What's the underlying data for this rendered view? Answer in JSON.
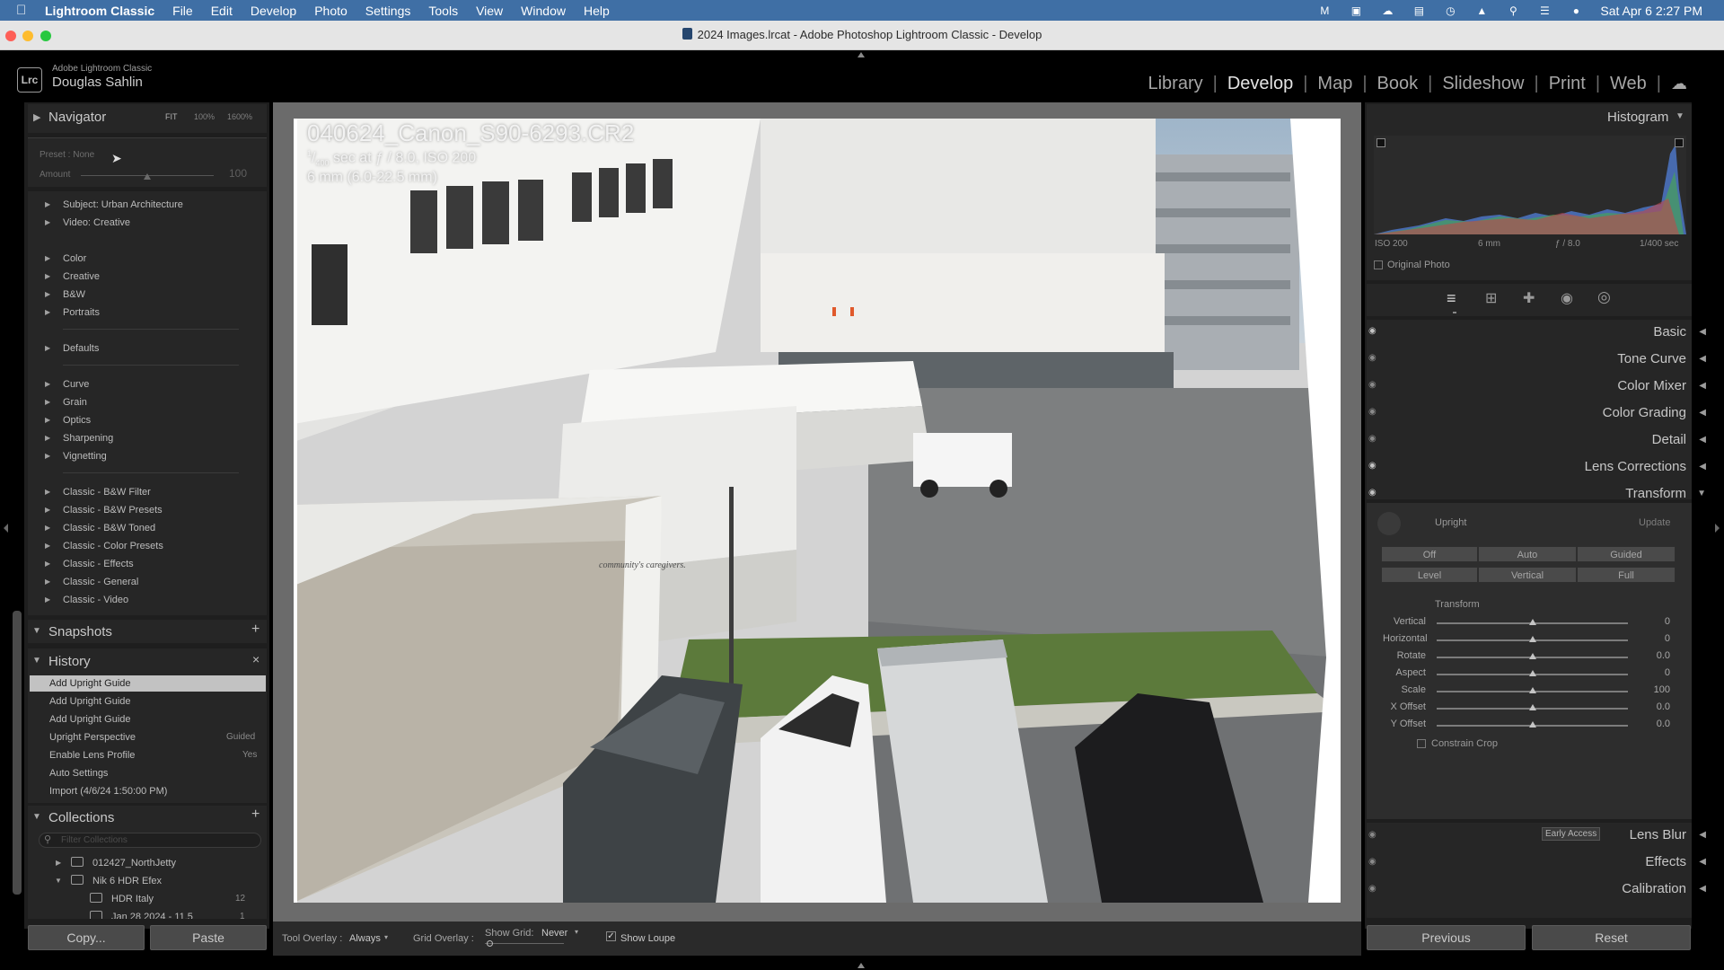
{
  "menubar": {
    "app": "Lightroom Classic",
    "items": [
      "File",
      "Edit",
      "Develop",
      "Photo",
      "Settings",
      "Tools",
      "View",
      "Window",
      "Help"
    ],
    "clock": "Sat Apr 6  2:27 PM"
  },
  "window": {
    "title": "2024 Images.lrcat - Adobe Photoshop Lightroom Classic - Develop"
  },
  "identity": {
    "logo": "Lrc",
    "brand": "Adobe Lightroom Classic",
    "user": "Douglas Sahlin"
  },
  "modules": [
    "Library",
    "Develop",
    "Map",
    "Book",
    "Slideshow",
    "Print",
    "Web"
  ],
  "navigator": {
    "title": "Navigator",
    "zoom": [
      "FIT",
      "100%",
      "1600%"
    ]
  },
  "preset_amount": {
    "preset_label": "Preset : None",
    "amount_label": "Amount",
    "amount_value": "100"
  },
  "presets": {
    "group1": [
      "Subject: Urban Architecture",
      "Video: Creative"
    ],
    "group2": [
      "Color",
      "Creative",
      "B&W",
      "Portraits"
    ],
    "group3": [
      "Defaults"
    ],
    "group4": [
      "Curve",
      "Grain",
      "Optics",
      "Sharpening",
      "Vignetting"
    ],
    "group5": [
      "Classic - B&W Filter",
      "Classic - B&W Presets",
      "Classic - B&W Toned",
      "Classic - Color Presets",
      "Classic - Effects",
      "Classic - General",
      "Classic - Video"
    ]
  },
  "snapshots": {
    "title": "Snapshots"
  },
  "history": {
    "title": "History",
    "items": [
      {
        "label": "Add Upright Guide",
        "value": ""
      },
      {
        "label": "Add Upright Guide",
        "value": ""
      },
      {
        "label": "Add Upright Guide",
        "value": ""
      },
      {
        "label": "Upright Perspective",
        "value": "Guided"
      },
      {
        "label": "Enable Lens Profile",
        "value": "Yes"
      },
      {
        "label": "Auto Settings",
        "value": ""
      },
      {
        "label": "Import (4/6/24 1:50:00 PM)",
        "value": ""
      }
    ]
  },
  "collections": {
    "title": "Collections",
    "filter_placeholder": "Filter Collections",
    "items": [
      {
        "label": "012427_NorthJetty",
        "count": ""
      },
      {
        "label": "Nik 6 HDR Efex",
        "count": ""
      },
      {
        "label": "HDR Italy",
        "count": "12"
      },
      {
        "label": "Jan 28 2024 - 11.5",
        "count": "1"
      }
    ]
  },
  "left_buttons": {
    "copy": "Copy...",
    "paste": "Paste"
  },
  "photo_info": {
    "filename": "040624_Canon_S90-6293.CR2",
    "exposure_denominator": "400",
    "exposure": "sec at ƒ / 8.0, ISO 200",
    "focal": "6 mm (6.0-22.5 mm)",
    "photo_text": "community's caregivers."
  },
  "toolbar": {
    "tool_overlay_label": "Tool Overlay :",
    "tool_overlay_value": "Always",
    "grid_overlay_label": "Grid Overlay :",
    "show_grid_label": "Show Grid:",
    "show_grid_value": "Never",
    "show_loupe": "Show Loupe"
  },
  "histogram": {
    "title": "Histogram",
    "iso": "ISO 200",
    "focal": "6 mm",
    "aperture": "ƒ / 8.0",
    "shutter": "1/400 sec",
    "original_photo": "Original Photo"
  },
  "tools": [
    "edit-icon",
    "crop-icon",
    "heal-icon",
    "redeye-icon",
    "masking-icon"
  ],
  "sections": [
    "Basic",
    "Tone Curve",
    "Color Mixer",
    "Color Grading",
    "Detail",
    "Lens Corrections",
    "Transform"
  ],
  "transform": {
    "upright_label": "Upright",
    "update_label": "Update",
    "upright_buttons": [
      "Off",
      "Auto",
      "Guided",
      "Level",
      "Vertical",
      "Full"
    ],
    "subheader": "Transform",
    "sliders": [
      {
        "label": "Vertical",
        "value": "0",
        "position": 0.5
      },
      {
        "label": "Horizontal",
        "value": "0",
        "position": 0.5
      },
      {
        "label": "Rotate",
        "value": "0.0",
        "position": 0.5
      },
      {
        "label": "Aspect",
        "value": "0",
        "position": 0.5
      },
      {
        "label": "Scale",
        "value": "100",
        "position": 0.5
      },
      {
        "label": "X Offset",
        "value": "0.0",
        "position": 0.5
      },
      {
        "label": "Y Offset",
        "value": "0.0",
        "position": 0.5
      }
    ],
    "constrain_crop": "Constrain Crop"
  },
  "bottom_sections": {
    "early_access": "Early Access",
    "lens_blur": "Lens Blur",
    "effects": "Effects",
    "calibration": "Calibration"
  },
  "right_buttons": {
    "previous": "Previous",
    "reset": "Reset"
  }
}
